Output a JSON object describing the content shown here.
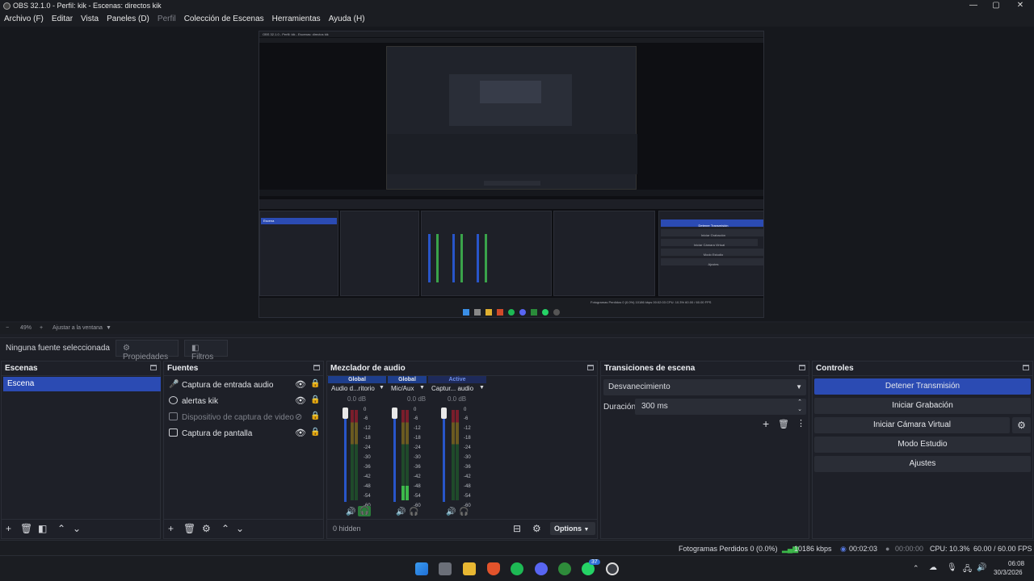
{
  "window": {
    "title": "OBS 32.1.0 - Perfil: kik - Escenas: directos kik",
    "controls": [
      "—",
      "▢",
      "✕"
    ]
  },
  "menu": [
    "Archivo (F)",
    "Editar",
    "Vista",
    "Paneles (D)",
    "Perfil",
    "Colección de Escenas",
    "Herramientas",
    "Ayuda (H)"
  ],
  "preview": {
    "nested_title": "OBS 32.1.0 - Perfil: kik - Escenas: directos kik",
    "nested_scene_label": "Escena",
    "nested_controls": [
      "Detener Transmisión",
      "Iniciar Grabación",
      "Iniciar Cámara Virtual",
      "Modo Estudio",
      "Ajustes"
    ],
    "nested_status": "Fotogramas Perdidos 0 (0.0%)   10186 kbps   00:02:03   CPU: 10.3%   60.00 / 60.00 FPS"
  },
  "zoom": {
    "minus": "−",
    "value": "49%",
    "plus": "+",
    "fit": "Ajustar a la ventana",
    "arrow": "▼"
  },
  "sourcebar": {
    "no_selection": "Ninguna fuente seleccionada",
    "properties": "Propiedades",
    "filters": "Filtros"
  },
  "scenes": {
    "title": "Escenas",
    "items": [
      "Escena"
    ]
  },
  "sources": {
    "title": "Fuentes",
    "items": [
      {
        "name": "Captura de entrada audio",
        "visible": true
      },
      {
        "name": "alertas kik",
        "visible": true
      },
      {
        "name": "Dispositivo de captura de video",
        "visible": false
      },
      {
        "name": "Captura de pantalla",
        "visible": true
      }
    ]
  },
  "mixer": {
    "title": "Mezclador de audio",
    "channels": [
      {
        "tag": "Global",
        "name": "Audio d...ritorio",
        "db": "0.0 dB"
      },
      {
        "tag": "Global",
        "name": "Mic/Aux",
        "db": "0.0 dB"
      },
      {
        "tag": "Active",
        "name": "Captur... audio",
        "db": "0.0 dB"
      }
    ],
    "ticks": [
      "0",
      "-6",
      "-12",
      "-18",
      "-24",
      "-30",
      "-36",
      "-42",
      "-48",
      "-54",
      "-60"
    ],
    "hidden": "0 hidden",
    "options": "Options"
  },
  "transitions": {
    "title": "Transiciones de escena",
    "selected": "Desvanecimiento",
    "duration_label": "Duración",
    "duration": "300 ms"
  },
  "controls": {
    "title": "Controles",
    "buttons": [
      "Detener Transmisión",
      "Iniciar Grabación",
      "Iniciar Cámara Virtual",
      "Modo Estudio",
      "Ajustes"
    ]
  },
  "status": {
    "dropped": "Fotogramas Perdidos 0 (0.0%)",
    "bitrate": "10186 kbps",
    "stream_time": "00:02:03",
    "rec_time": "00:00:00",
    "cpu": "CPU: 10.3%",
    "fps": "60.00 / 60.00 FPS"
  },
  "taskbar": {
    "time": "06:08",
    "date": "30/3/2026",
    "badge": "37"
  },
  "colors": {
    "accent": "#2b4bb3",
    "bg": "#1e2028",
    "live_green": "#3cb84a",
    "warn_red": "#c0354a"
  }
}
